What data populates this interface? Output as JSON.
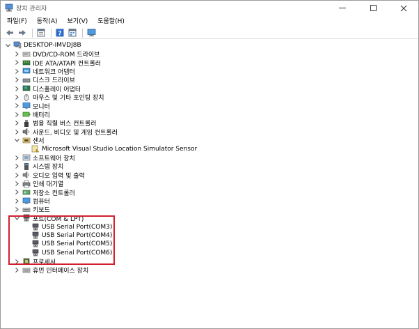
{
  "window": {
    "title": "장치 관리자",
    "controls": {
      "minimize": "—",
      "maximize": "☐",
      "close": "✕"
    }
  },
  "menu": {
    "items": [
      "파일(F)",
      "동작(A)",
      "보기(V)",
      "도움말(H)"
    ]
  },
  "toolbar": {
    "buttons": [
      "back-icon",
      "forward-icon",
      "properties-icon",
      "help-icon",
      "device-view-icon",
      "monitor-icon"
    ]
  },
  "tree": {
    "root": {
      "label": "DESKTOP-IMVDJ8B",
      "icon": "computer-icon",
      "expanded": true
    },
    "categories": [
      {
        "label": "DVD/CD-ROM 드라이브",
        "icon": "dvd-icon",
        "expanded": false
      },
      {
        "label": "IDE ATA/ATAPI 컨트롤러",
        "icon": "ide-icon",
        "expanded": false
      },
      {
        "label": "네트워크 어댑터",
        "icon": "network-icon",
        "expanded": false
      },
      {
        "label": "디스크 드라이브",
        "icon": "disk-icon",
        "expanded": false
      },
      {
        "label": "디스플레이 어댑터",
        "icon": "display-adapter-icon",
        "expanded": false
      },
      {
        "label": "마우스 및 기타 포인팅 장치",
        "icon": "mouse-icon",
        "expanded": false
      },
      {
        "label": "모니터",
        "icon": "monitor-icon",
        "expanded": false
      },
      {
        "label": "배터리",
        "icon": "battery-icon",
        "expanded": false
      },
      {
        "label": "범용 직렬 버스 컨트롤러",
        "icon": "usb-icon",
        "expanded": false
      },
      {
        "label": "사운드, 비디오 및 게임 컨트롤러",
        "icon": "sound-icon",
        "expanded": false
      },
      {
        "label": "센서",
        "icon": "sensor-icon",
        "expanded": true,
        "children": [
          {
            "label": "Microsoft Visual Studio Location Simulator Sensor",
            "icon": "sensor-device-icon"
          }
        ]
      },
      {
        "label": "소프트웨어 장치",
        "icon": "software-device-icon",
        "expanded": false
      },
      {
        "label": "시스템 장치",
        "icon": "system-device-icon",
        "expanded": false
      },
      {
        "label": "오디오 입력 및 출력",
        "icon": "audio-icon",
        "expanded": false
      },
      {
        "label": "인쇄 대기열",
        "icon": "printer-icon",
        "expanded": false
      },
      {
        "label": "저장소 컨트롤러",
        "icon": "storage-icon",
        "expanded": false
      },
      {
        "label": "컴퓨터",
        "icon": "computer-small-icon",
        "expanded": false
      },
      {
        "label": "키보드",
        "icon": "keyboard-icon",
        "expanded": false
      },
      {
        "label": "포트(COM & LPT)",
        "icon": "port-icon",
        "expanded": true,
        "children": [
          {
            "label": "USB Serial Port(COM3)",
            "icon": "port-icon"
          },
          {
            "label": "USB Serial Port(COM4)",
            "icon": "port-icon"
          },
          {
            "label": "USB Serial Port(COM5)",
            "icon": "port-icon"
          },
          {
            "label": "USB Serial Port(COM6)",
            "icon": "port-icon"
          }
        ]
      },
      {
        "label": "프로세서",
        "icon": "processor-icon",
        "expanded": false
      },
      {
        "label": "휴먼 인터페이스 장치",
        "icon": "hid-icon",
        "expanded": false
      }
    ]
  },
  "highlight": {
    "color": "#d11f2f"
  }
}
